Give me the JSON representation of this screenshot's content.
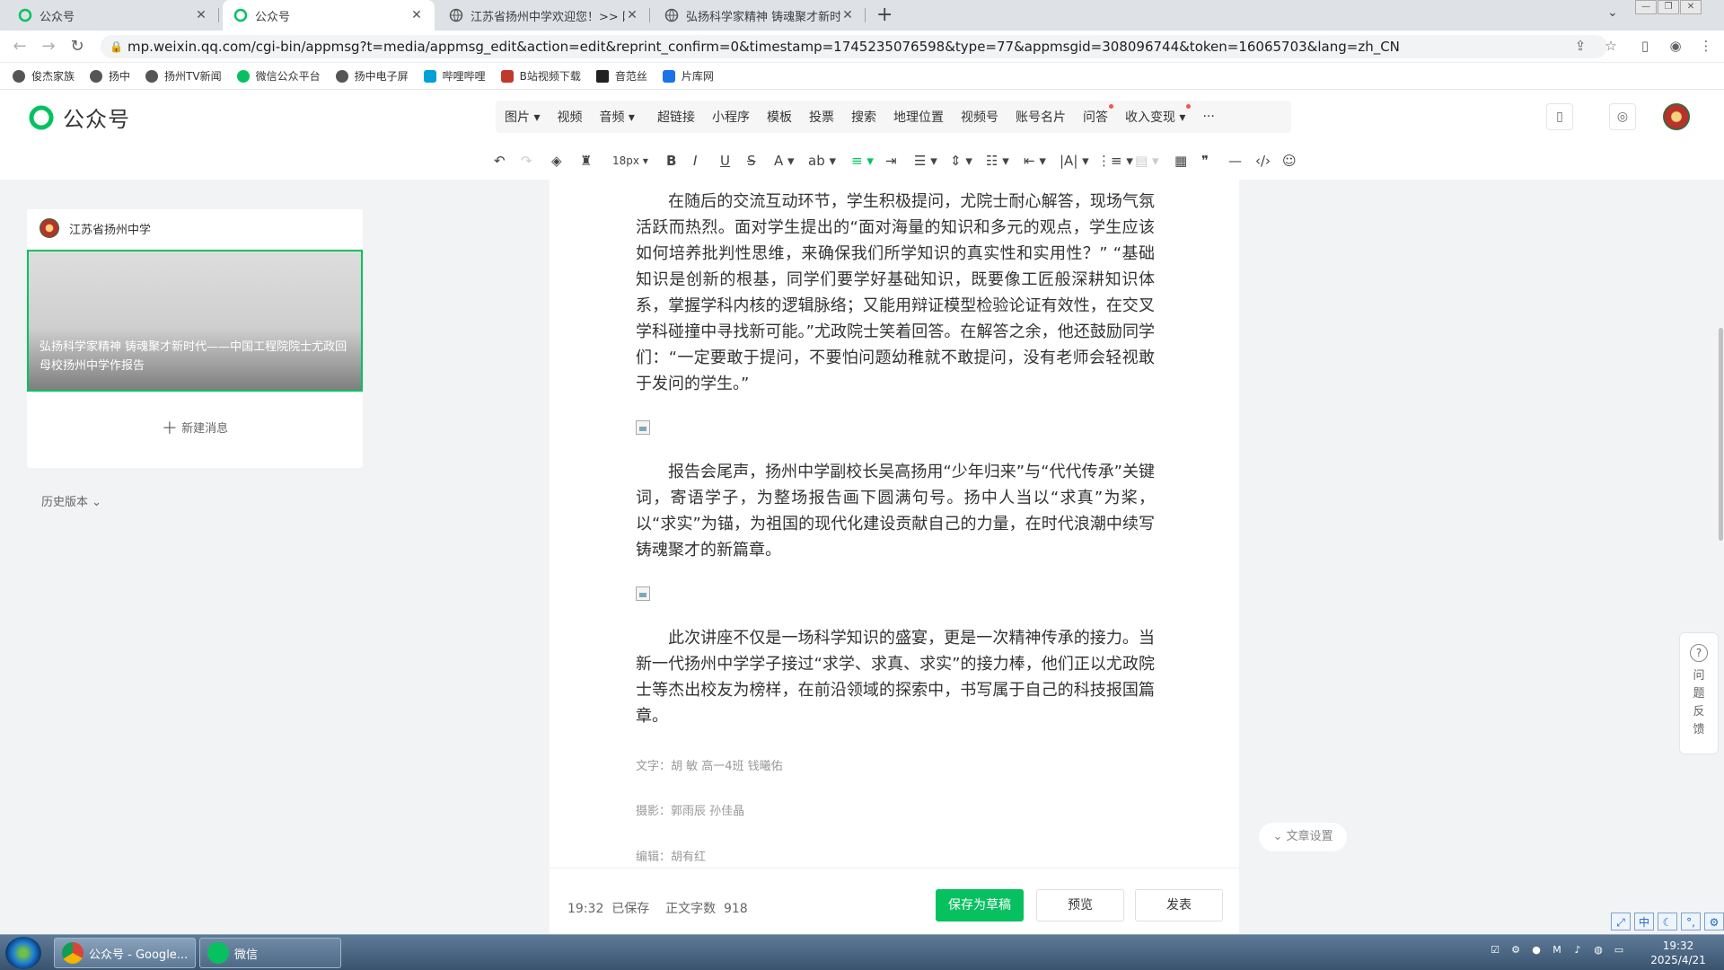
{
  "browser": {
    "tabs": [
      {
        "title": "公众号"
      },
      {
        "title": "公众号"
      },
      {
        "title": "江苏省扬州中学欢迎您！>> 网"
      },
      {
        "title": "弘扬科学家精神 铸魂聚才新时代"
      }
    ],
    "url": "mp.weixin.qq.com/cgi-bin/appmsg?t=media/appmsg_edit&action=edit&reprint_confirm=0&timestamp=1745235076598&type=77&appmsgid=308096744&token=16065703&lang=zh_CN",
    "bookmarks": [
      "俊杰家族",
      "扬中",
      "扬州TV新闻",
      "微信公众平台",
      "扬中电子屏",
      "哔哩哔哩",
      "B站视频下载",
      "音范丝",
      "片库网"
    ]
  },
  "app": {
    "logo": "公众号",
    "menu": [
      "图片",
      "视频",
      "音频",
      "超链接",
      "小程序",
      "模板",
      "投票",
      "搜索",
      "地理位置",
      "视频号",
      "账号名片",
      "问答",
      "收入变现",
      "···"
    ],
    "font_size": "18px"
  },
  "left": {
    "account": "江苏省扬州中学",
    "article_title": "弘扬科学家精神 铸魂聚才新时代——中国工程院院士尤政回母校扬州中学作报告",
    "new_message": "新建消息",
    "history": "历史版本"
  },
  "content": {
    "p1": "在随后的交流互动环节，学生积极提问，尤院士耐心解答，现场气氛活跃而热烈。面对学生提出的“面对海量的知识和多元的观点，学生应该如何培养批判性思维，来确保我们所学知识的真实性和实用性？” “基础知识是创新的根基，同学们要学好基础知识，既要像工匠般深耕知识体系，掌握学科内核的逻辑脉络；又能用辩证模型检验论证有效性，在交叉学科碰撞中寻找新可能。”尤政院士笑着回答。在解答之余，他还鼓励同学们：“一定要敢于提问，不要怕问题幼稚就不敢提问，没有老师会轻视敢于发问的学生。”",
    "p2": "报告会尾声，扬州中学副校长吴高扬用“少年归来”与“代代传承”关键词，寄语学子，为整场报告画下圆满句号。扬中人当以“求真”为桨，以“求实”为锚，为祖国的现代化建设贡献自己的力量，在时代浪潮中续写铸魂聚才的新篇章。",
    "p3": "此次讲座不仅是一场科学知识的盛宴，更是一次精神传承的接力。当新一代扬州中学学子接过“求学、求真、求实”的接力棒，他们正以尤政院士等杰出校友为榜样，在前沿领域的探索中，书写属于自己的科技报国篇章。",
    "credit_text": "文字：胡  敏  高一4班 钱曦佑",
    "credit_photo": "摄影：郭雨辰  孙佳晶",
    "credit_editor": "编辑：胡有红"
  },
  "footer": {
    "time": "19:32",
    "saved": "已保存",
    "word_count_label": "正文字数",
    "word_count": "918",
    "save_draft": "保存为草稿",
    "preview": "预览",
    "publish": "发表"
  },
  "side": {
    "article_settings": "文章设置",
    "feedback": "问题反馈"
  },
  "taskbar": {
    "chrome_task": "公众号 - Google...",
    "wechat_task": "微信",
    "time": "19:32",
    "date": "2025/4/21"
  },
  "colors": {
    "accent": "#07c160",
    "red_dot": "#fa5151"
  }
}
